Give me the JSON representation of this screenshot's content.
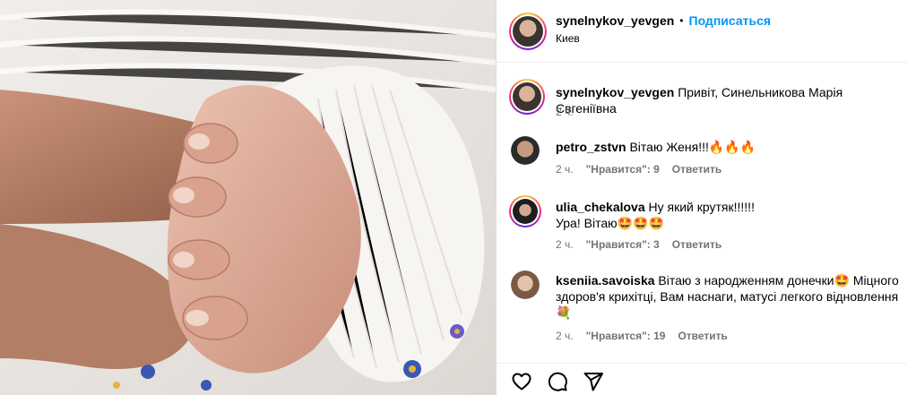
{
  "post": {
    "author": "synelnykov_yevgen",
    "dot": "•",
    "follow_label": "Подписаться",
    "location": "Киев",
    "caption": "Привіт, Синельникова Марія Євгеніївна",
    "caption_time": "2 ч."
  },
  "comments": [
    {
      "user": "petro_zstvn",
      "text": "Вітаю Женя!!!🔥🔥🔥",
      "line2": "",
      "time": "2 ч.",
      "likes": "\"Нравится\": 9",
      "reply": "Ответить"
    },
    {
      "user": "ulia_chekalova",
      "text": "Ну який крутяк!!!!!!",
      "line2": "Ура! Вітаю🤩🤩🤩",
      "time": "2 ч.",
      "likes": "\"Нравится\": 3",
      "reply": "Ответить"
    },
    {
      "user": "kseniia.savoiska",
      "text": "Вітаю з народженням донечки🤩 Міцного",
      "line2": "здоров'я крихітці, Вам наснаги, матусі легкого відновлення",
      "line3": "💐",
      "time": "2 ч.",
      "likes": "\"Нравится\": 19",
      "reply": "Ответить"
    }
  ],
  "actions": {
    "like_icon": "heart-icon",
    "comment_icon": "comment-icon",
    "share_icon": "send-icon"
  },
  "colors": {
    "link": "#0095f6",
    "muted": "#737373"
  }
}
